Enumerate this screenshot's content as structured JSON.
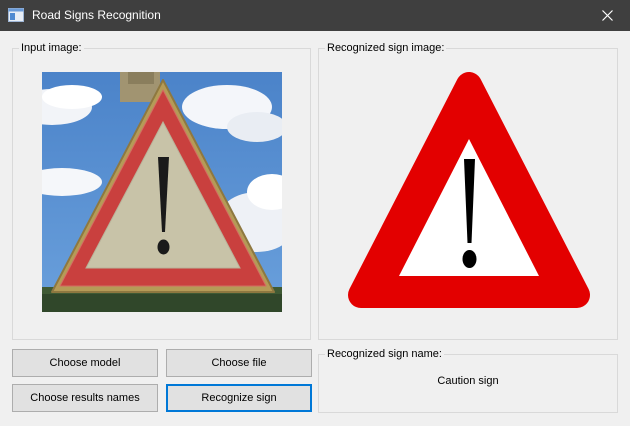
{
  "window": {
    "title": "Road Signs Recognition",
    "icon": "app-window-icon"
  },
  "input_group": {
    "label": "Input image:"
  },
  "recognized_group": {
    "label": "Recognized sign image:"
  },
  "name_group": {
    "label": "Recognized sign name:",
    "value": "Caution sign"
  },
  "buttons": {
    "choose_model": "Choose model",
    "choose_file": "Choose file",
    "choose_results": "Choose results names",
    "recognize": "Recognize sign"
  },
  "colors": {
    "titlebar": "#3f3f3f",
    "sign_red": "#e30000",
    "focus_border": "#0078d7"
  }
}
